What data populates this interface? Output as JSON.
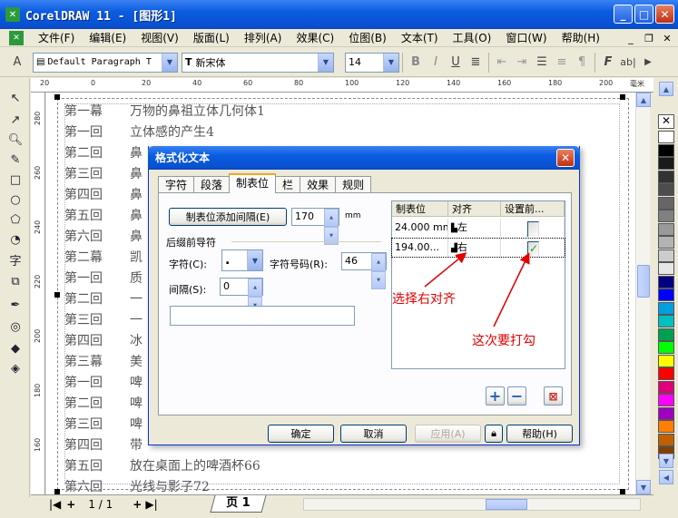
{
  "window": {
    "title": "CorelDRAW 11 - [图形1]",
    "app_icon": "CorelDRAW-icon"
  },
  "menu": [
    "文件(F)",
    "编辑(E)",
    "视图(V)",
    "版面(L)",
    "排列(A)",
    "效果(C)",
    "位图(B)",
    "文本(T)",
    "工具(O)",
    "窗口(W)",
    "帮助(H)"
  ],
  "propbar": {
    "style_combo": "Default Paragraph T",
    "font_combo": "新宋体",
    "size_combo": "14",
    "font_prefix": "T"
  },
  "ruler": {
    "h_labels": [
      "20",
      "0",
      "20",
      "40",
      "60",
      "80",
      "100",
      "120",
      "140",
      "160",
      "180",
      "200"
    ],
    "h_unit": "毫米",
    "v_labels": [
      "280",
      "260",
      "240",
      "220",
      "200",
      "180",
      "160"
    ]
  },
  "document": {
    "lines": [
      {
        "a": "第一幕",
        "b": "万物的鼻祖立体几何体1"
      },
      {
        "a": "第一回",
        "b": "立体感的产生4"
      },
      {
        "a": "第二回",
        "b": "鼻"
      },
      {
        "a": "第三回",
        "b": "鼻"
      },
      {
        "a": "第四回",
        "b": "鼻"
      },
      {
        "a": "第五回",
        "b": "鼻"
      },
      {
        "a": "第六回",
        "b": "鼻"
      },
      {
        "a": "第二幕",
        "b": "凯"
      },
      {
        "a": "第一回",
        "b": "质"
      },
      {
        "a": "第二回",
        "b": "一"
      },
      {
        "a": "第三回",
        "b": "一"
      },
      {
        "a": "第四回",
        "b": "冰"
      },
      {
        "a": "第三幕",
        "b": "美"
      },
      {
        "a": "第一回",
        "b": "啤"
      },
      {
        "a": "第二回",
        "b": "啤"
      },
      {
        "a": "第三回",
        "b": "啤"
      },
      {
        "a": "第四回",
        "b": "带"
      },
      {
        "a": "第五回",
        "b": "放在桌面上的啤酒杯66"
      },
      {
        "a": "第六回",
        "b": "光线与影子72"
      }
    ]
  },
  "pager": {
    "page_count": "1 / 1",
    "page_tab": "页 1"
  },
  "dialog": {
    "title": "格式化文本",
    "tabs": [
      "字符",
      "段落",
      "制表位",
      "栏",
      "效果",
      "规则"
    ],
    "active_tab": "制表位",
    "add_tab_button": "制表位添加间隔(E)",
    "add_tab_value": "170",
    "add_tab_unit": "mm",
    "leader_group": "后缀前导符",
    "char_label": "字符(C):",
    "char_value": ".",
    "char_code_label": "字符号码(R):",
    "char_code_value": "46",
    "spacing_label": "间隔(S):",
    "spacing_value": "0",
    "table_headers": [
      "制表位",
      "对齐",
      "设置前..."
    ],
    "rows": [
      {
        "pos": "24.000 mm",
        "align": "左",
        "set_before": false
      },
      {
        "pos": "194.00...",
        "align": "右",
        "set_before": true
      }
    ],
    "ok": "确定",
    "cancel": "取消",
    "apply": "应用(A)",
    "help": "帮助(H)"
  },
  "annotations": {
    "right_align": "选择右对齐",
    "check_this": "这次要打勾"
  },
  "palette": [
    "#ffffff",
    "#000000",
    "#1a1a1a",
    "#333333",
    "#4d4d4d",
    "#666666",
    "#808080",
    "#999999",
    "#b3b3b3",
    "#cccccc",
    "#e6e6e6",
    "#000080",
    "#0000ff",
    "#00a0e0",
    "#00c0c0",
    "#00a050",
    "#00ff00",
    "#ffff00",
    "#ff0000",
    "#e0007a",
    "#ff00ff",
    "#a000c0",
    "#ff8000",
    "#c06000",
    "#804000"
  ]
}
